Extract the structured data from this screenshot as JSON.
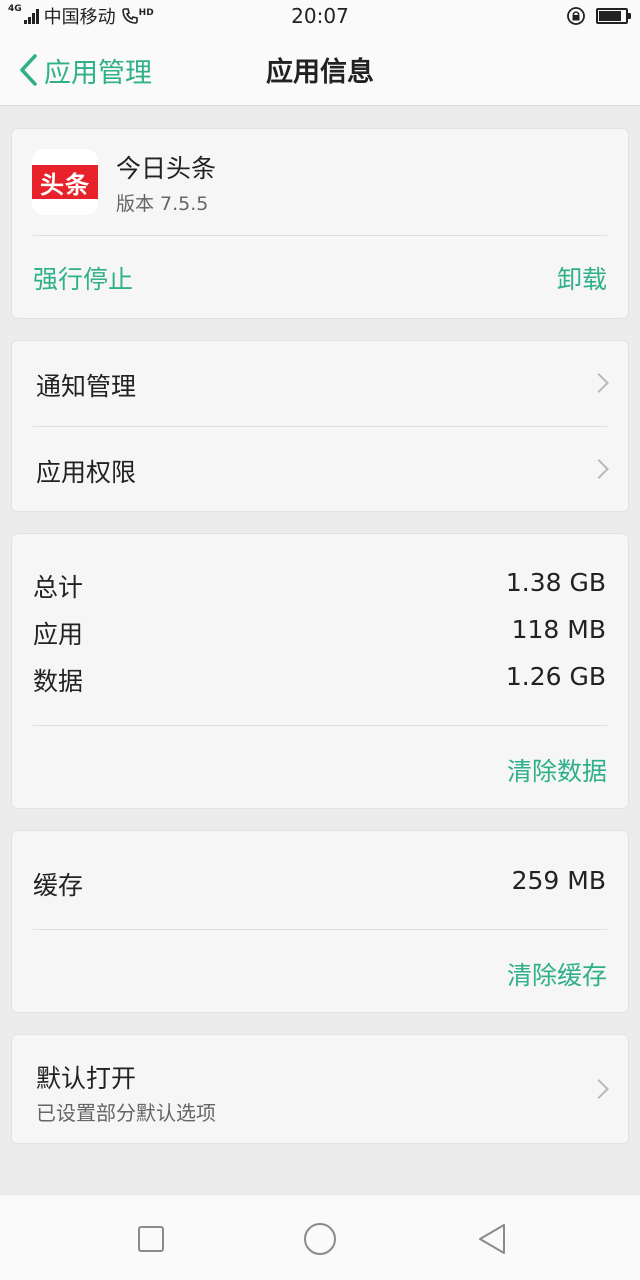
{
  "status_bar": {
    "network": "4G",
    "carrier": "中国移动",
    "call_badge": "HD",
    "time": "20:07",
    "battery_level": 0.85
  },
  "title_bar": {
    "back_label": "应用管理",
    "title": "应用信息"
  },
  "app": {
    "icon_text": "头条",
    "name": "今日头条",
    "version": "版本 7.5.5",
    "icon_color": "#e8222a",
    "force_stop_label": "强行停止",
    "uninstall_label": "卸载"
  },
  "settings_list": {
    "items": [
      {
        "label": "通知管理"
      },
      {
        "label": "应用权限"
      }
    ]
  },
  "storage": {
    "rows": [
      {
        "label": "总计",
        "value": "1.38 GB"
      },
      {
        "label": "应用",
        "value": "118 MB"
      },
      {
        "label": "数据",
        "value": "1.26 GB"
      }
    ],
    "clear_data_label": "清除数据"
  },
  "cache": {
    "label": "缓存",
    "value": "259 MB",
    "clear_cache_label": "清除缓存"
  },
  "default_open": {
    "label": "默认打开",
    "subtitle": "已设置部分默认选项"
  },
  "theme": {
    "accent": "#2fb089"
  }
}
